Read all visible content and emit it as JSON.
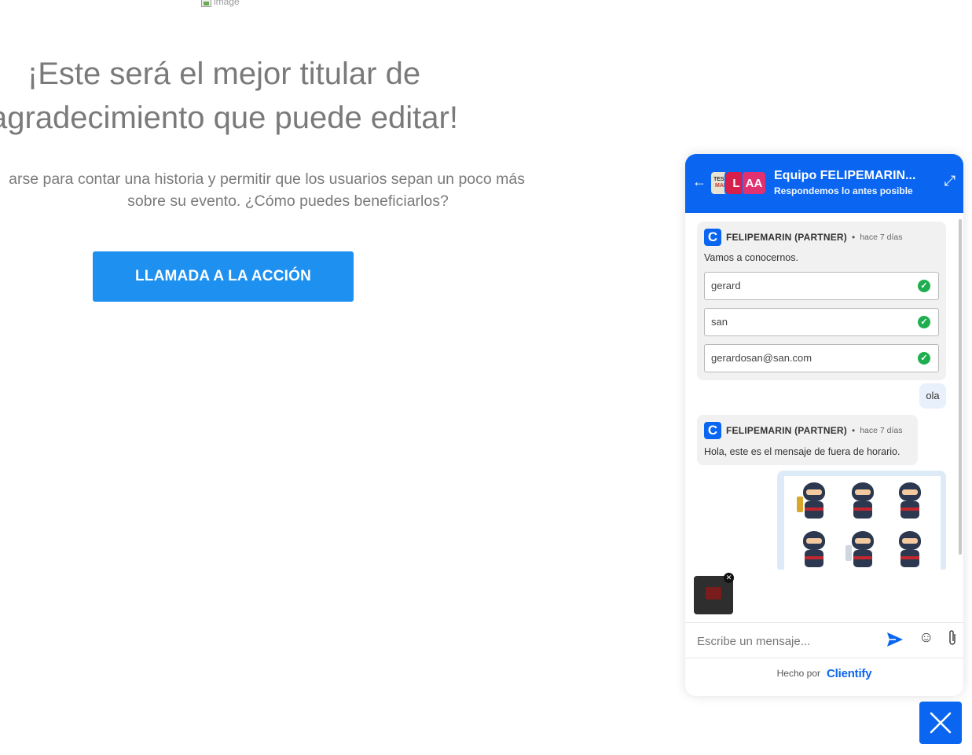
{
  "landing": {
    "broken_image_alt": "image",
    "headline": "¡Este será el mejor titular de\nagradecimiento que puede editar!",
    "subtext_line1": "arse para contar una historia y permitir que los usuarios sepan un poco más",
    "subtext_line2": "sobre su evento. ¿Cómo puedes beneficiarlos?",
    "cta_label": "LLAMADA A LA ACCIÓN"
  },
  "chat": {
    "header": {
      "title": "Equipo FELIPEMARIN...",
      "subtitle": "Respondemos lo antes posible",
      "avatar_image_text": "TESTI",
      "avatar_image_text2": "MAR",
      "avatar_l": "L",
      "avatar_aa": "AA",
      "back_icon": "arrow-left-icon",
      "expand_icon": "expand-icon"
    },
    "messages": [
      {
        "sender": "FELIPEMARIN (PARTNER)",
        "time": "hace 7 días",
        "text": "Vamos a conocernos.",
        "fields": [
          {
            "value": "gerard",
            "status": "valid"
          },
          {
            "value": "san",
            "status": "valid"
          },
          {
            "value": "gerardosan@san.com",
            "status": "valid"
          }
        ]
      },
      {
        "user_text": "ola"
      },
      {
        "sender": "FELIPEMARIN (PARTNER)",
        "time": "hace 7 días",
        "text": "Hola, este es el mensaje de fuera de horario."
      }
    ],
    "separator": "•",
    "composer": {
      "placeholder": "Escribe un mensaje...",
      "send_icon": "send-icon",
      "emoji_icon": "smiley-icon",
      "attach_icon": "paperclip-icon"
    },
    "footer": {
      "made_by": "Hecho por",
      "brand": "Clientify"
    },
    "colors": {
      "primary": "#0a66f0",
      "check": "#1fae4f",
      "cta": "#1e90f0"
    }
  }
}
